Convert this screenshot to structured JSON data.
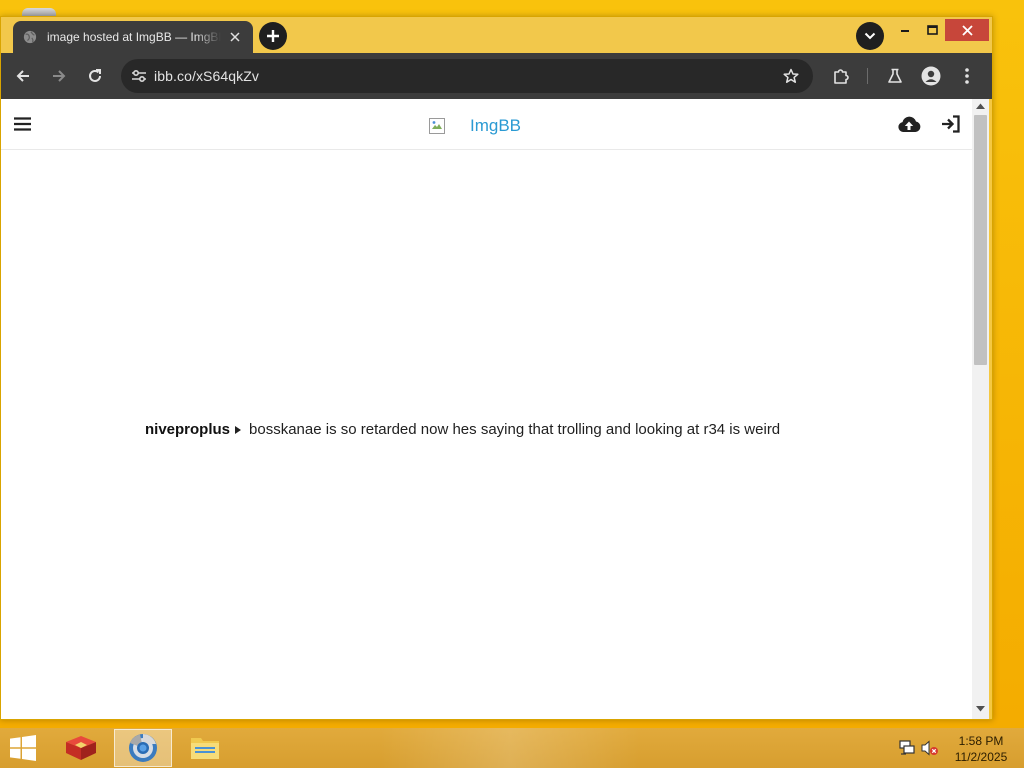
{
  "browser": {
    "tab_title": "image hosted at ImgBB — ImgBB",
    "url": "ibb.co/xS64qkZv"
  },
  "page": {
    "logo_alt": "ImgBB",
    "message_author": "niveproplus",
    "message_text": "bosskanae is so retarded now hes saying that trolling and looking at r34 is weird"
  },
  "taskbar": {
    "time": "1:58 PM",
    "date": "11/2/2025"
  },
  "icons": {
    "tab_favicon": "globe-icon",
    "tab_close": "close-icon",
    "new_tab": "plus-icon",
    "tab_search": "chevron-down-icon",
    "back": "arrow-left-icon",
    "forward": "arrow-right-icon",
    "reload": "reload-icon",
    "site_info": "tune-icon",
    "bookmark": "star-icon",
    "extensions": "puzzle-icon",
    "labs": "flask-icon",
    "profile": "person-icon",
    "menu": "kebab-icon",
    "site_menu": "hamburger-icon",
    "upload": "cloud-upload-icon",
    "sign_in": "sign-in-icon"
  },
  "colors": {
    "wallpaper": "#f6b800",
    "titlebar": "#f2c84b",
    "toolbar": "#3c3c3c",
    "logo_text": "#2a9ad3",
    "close_button": "#c7463a"
  }
}
